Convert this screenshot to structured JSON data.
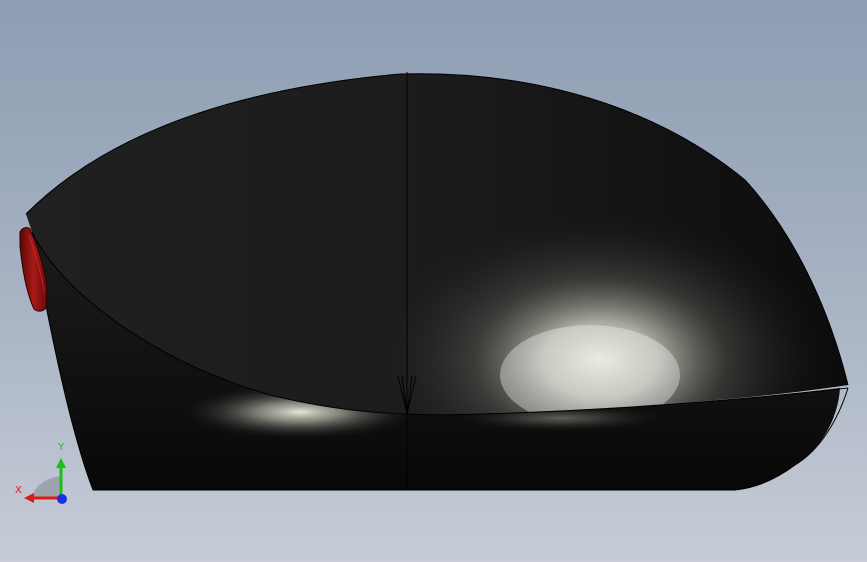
{
  "viewport": {
    "background_top": "#8d9db2",
    "background_bottom": "#c7ccd7"
  },
  "model": {
    "body_color": "#1a1a1a",
    "button_color": "#8c1010",
    "highlight_color": "#f4f4e6",
    "edge_color": "#000000",
    "symbol": "downward-arrow"
  },
  "triad": {
    "x_label": "X",
    "y_label": "Y",
    "x_color": "#e01818",
    "y_color": "#18c018",
    "z_color": "#1830e0"
  }
}
